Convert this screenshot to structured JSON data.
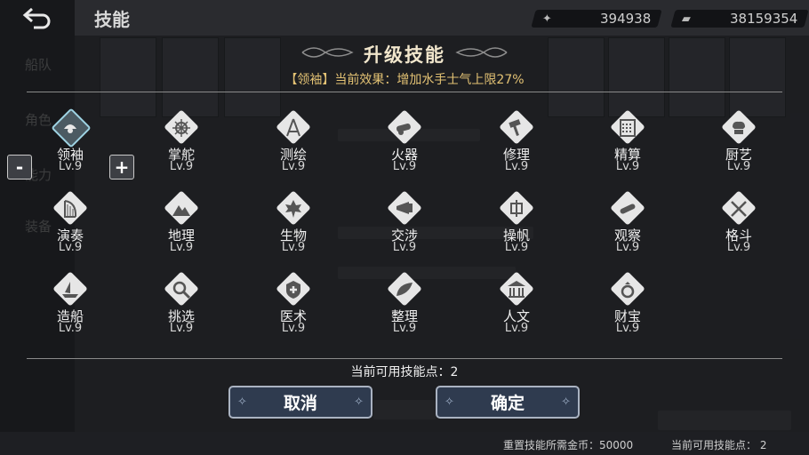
{
  "header": {
    "title": "技能",
    "currency_1": "394938",
    "currency_2": "38159354"
  },
  "background": {
    "side_tabs": [
      "船队",
      "角色",
      "能力",
      "装备"
    ],
    "footer_reset_cost": "重置技能所需金币：50000",
    "footer_points": "当前可用技能点：  2"
  },
  "modal": {
    "title": "升级技能",
    "current_effect": "【领袖】当前效果：增加水手士气上限27%",
    "skill_points_text": "当前可用技能点：2",
    "cancel_label": "取消",
    "confirm_label": "确定",
    "stepper_minus": "-",
    "stepper_plus": "+",
    "skills": [
      {
        "name": "领袖",
        "level": "Lv.9",
        "icon": "captain-hat-icon",
        "selected": true
      },
      {
        "name": "掌舵",
        "level": "Lv.9",
        "icon": "ship-wheel-icon"
      },
      {
        "name": "测绘",
        "level": "Lv.9",
        "icon": "compass-icon"
      },
      {
        "name": "火器",
        "level": "Lv.9",
        "icon": "cannon-icon"
      },
      {
        "name": "修理",
        "level": "Lv.9",
        "icon": "hammer-icon"
      },
      {
        "name": "精算",
        "level": "Lv.9",
        "icon": "abacus-icon"
      },
      {
        "name": "厨艺",
        "level": "Lv.9",
        "icon": "chef-hat-icon"
      },
      {
        "name": "演奏",
        "level": "Lv.9",
        "icon": "harp-icon"
      },
      {
        "name": "地理",
        "level": "Lv.9",
        "icon": "mountain-icon"
      },
      {
        "name": "生物",
        "level": "Lv.9",
        "icon": "leaf-icon"
      },
      {
        "name": "交涉",
        "level": "Lv.9",
        "icon": "horn-icon"
      },
      {
        "name": "操帆",
        "level": "Lv.9",
        "icon": "sail-icon"
      },
      {
        "name": "观察",
        "level": "Lv.9",
        "icon": "telescope-icon"
      },
      {
        "name": "格斗",
        "level": "Lv.9",
        "icon": "crossed-swords-icon"
      },
      {
        "name": "造船",
        "level": "Lv.9",
        "icon": "ship-icon"
      },
      {
        "name": "挑选",
        "level": "Lv.9",
        "icon": "magnifier-icon"
      },
      {
        "name": "医术",
        "level": "Lv.9",
        "icon": "medical-cross-icon"
      },
      {
        "name": "整理",
        "level": "Lv.9",
        "icon": "feather-icon"
      },
      {
        "name": "人文",
        "level": "Lv.9",
        "icon": "temple-icon"
      },
      {
        "name": "财宝",
        "level": "Lv.9",
        "icon": "ring-icon"
      }
    ]
  },
  "colors": {
    "accent_gold": "#e3c274",
    "selected_border": "#9ed3e3",
    "button_bg": "#2f3b4f"
  }
}
